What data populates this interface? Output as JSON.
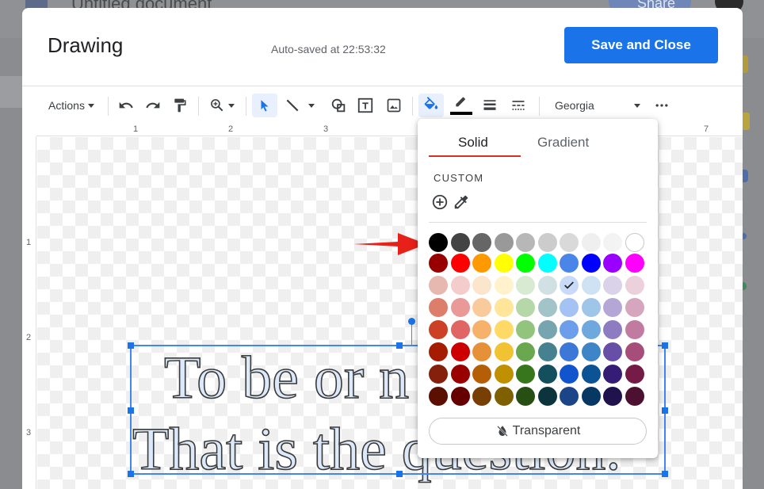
{
  "background": {
    "doc_title": "Untitled document",
    "share_label": "Share"
  },
  "dialog": {
    "title": "Drawing",
    "autosave": "Auto-saved at 22:53:32",
    "save_label": "Save and Close"
  },
  "toolbar": {
    "actions_label": "Actions",
    "font_name": "Georgia",
    "icons": [
      "undo-icon",
      "redo-icon",
      "paint-format-icon",
      "zoom-icon",
      "select-icon",
      "line-icon",
      "shape-icon",
      "textbox-icon",
      "image-icon",
      "fill-color-icon",
      "border-color-icon",
      "border-weight-icon",
      "border-dash-icon",
      "more-icon"
    ],
    "border_color": "#000000",
    "accent_color": "#1a73e8"
  },
  "ruler": {
    "top_ticks": [
      "1",
      "2",
      "3",
      "7"
    ],
    "left_ticks": [
      "1",
      "2",
      "3"
    ]
  },
  "canvas": {
    "line1": "To be or n",
    "line2": "That is the question."
  },
  "color_popup": {
    "tabs": [
      {
        "label": "Solid",
        "active": true
      },
      {
        "label": "Gradient",
        "active": false
      }
    ],
    "custom_label": "CUSTOM",
    "transparent_label": "Transparent",
    "selected_color": "#c9daf8",
    "palette": [
      [
        "#000000",
        "#434343",
        "#666666",
        "#999999",
        "#b7b7b7",
        "#cccccc",
        "#d9d9d9",
        "#efefef",
        "#f3f3f3",
        "#ffffff"
      ],
      [
        "#980000",
        "#ff0000",
        "#ff9900",
        "#ffff00",
        "#00ff00",
        "#00ffff",
        "#4a86e8",
        "#0000ff",
        "#9900ff",
        "#ff00ff"
      ],
      [
        "#e6b8af",
        "#f4cccc",
        "#fce5cd",
        "#fff2cc",
        "#d9ead3",
        "#d0e0e3",
        "#c9daf8",
        "#cfe2f3",
        "#d9d2e9",
        "#ead1dc"
      ],
      [
        "#dd7e6b",
        "#ea9999",
        "#f9cb9c",
        "#ffe599",
        "#b6d7a8",
        "#a2c4c9",
        "#a4c2f4",
        "#9fc5e8",
        "#b4a7d6",
        "#d5a6bd"
      ],
      [
        "#cc4125",
        "#e06666",
        "#f6b26b",
        "#ffd966",
        "#93c47d",
        "#76a5af",
        "#6d9eeb",
        "#6fa8dc",
        "#8e7cc3",
        "#c27ba0"
      ],
      [
        "#a61c00",
        "#cc0000",
        "#e69138",
        "#f1c232",
        "#6aa84f",
        "#45818e",
        "#3c78d8",
        "#3d85c6",
        "#674ea7",
        "#a64d79"
      ],
      [
        "#85200c",
        "#990000",
        "#b45f06",
        "#bf9000",
        "#38761d",
        "#134f5c",
        "#1155cc",
        "#0b5394",
        "#351c75",
        "#741b47"
      ],
      [
        "#5b0f00",
        "#660000",
        "#783f04",
        "#7f6000",
        "#274e13",
        "#0c343d",
        "#1c4587",
        "#073763",
        "#20124d",
        "#4c1130"
      ]
    ]
  },
  "annotation": {
    "arrow_color": "#e8201a"
  }
}
